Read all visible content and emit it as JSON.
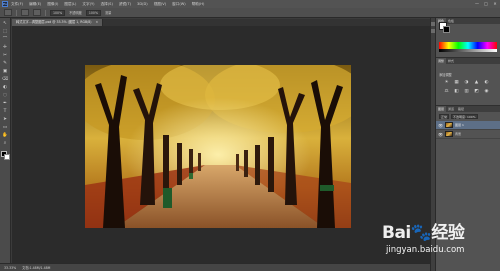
{
  "menubar": {
    "logo": "Ps",
    "items": [
      "文件(F)",
      "编辑(E)",
      "图像(I)",
      "图层(L)",
      "文字(Y)",
      "选择(S)",
      "滤镜(T)",
      "3D(D)",
      "视图(V)",
      "窗口(W)",
      "帮助(H)"
    ],
    "min_glyph": "—",
    "max_glyph": "□",
    "close_glyph": "✕"
  },
  "options": {
    "fields": [
      "100%",
      "不透明度",
      "100%",
      "流量"
    ]
  },
  "tabs": [
    {
      "label": "韩式文字...调整图层.psd @ 33.3% (图层 1, RGB/8)",
      "close": "×"
    }
  ],
  "toolbar": {
    "tools": [
      "↖",
      "⬚",
      "⌒",
      "✛",
      "✂",
      "✎",
      "▣",
      "⌫",
      "◐",
      "◌",
      "✒",
      "T",
      "➤",
      "▭",
      "✋",
      "⌕"
    ]
  },
  "statusbar": {
    "zoom": "33.33%",
    "doc": "文档:1.48M/1.48M"
  },
  "panels": {
    "top_tabs": [
      "颜色",
      "色板"
    ],
    "adjust_tabs": [
      "调整",
      "样式"
    ],
    "adjust_title": "添加调整",
    "adjust_icons": [
      "☀",
      "▦",
      "◑",
      "▲",
      "◐",
      "⚖",
      "◧",
      "▥",
      "◩",
      "◉"
    ],
    "layer_tabs": [
      "图层",
      "通道",
      "路径"
    ],
    "blend_mode": "正常",
    "opacity": "不透明度: 100%",
    "layers": [
      {
        "name": "图层 1",
        "eye": "👁",
        "selected": true
      },
      {
        "name": "背景",
        "eye": "👁",
        "selected": false
      }
    ]
  },
  "watermark": {
    "logo": "Bai🐾经验",
    "url": "jingyan.baidu.com"
  }
}
